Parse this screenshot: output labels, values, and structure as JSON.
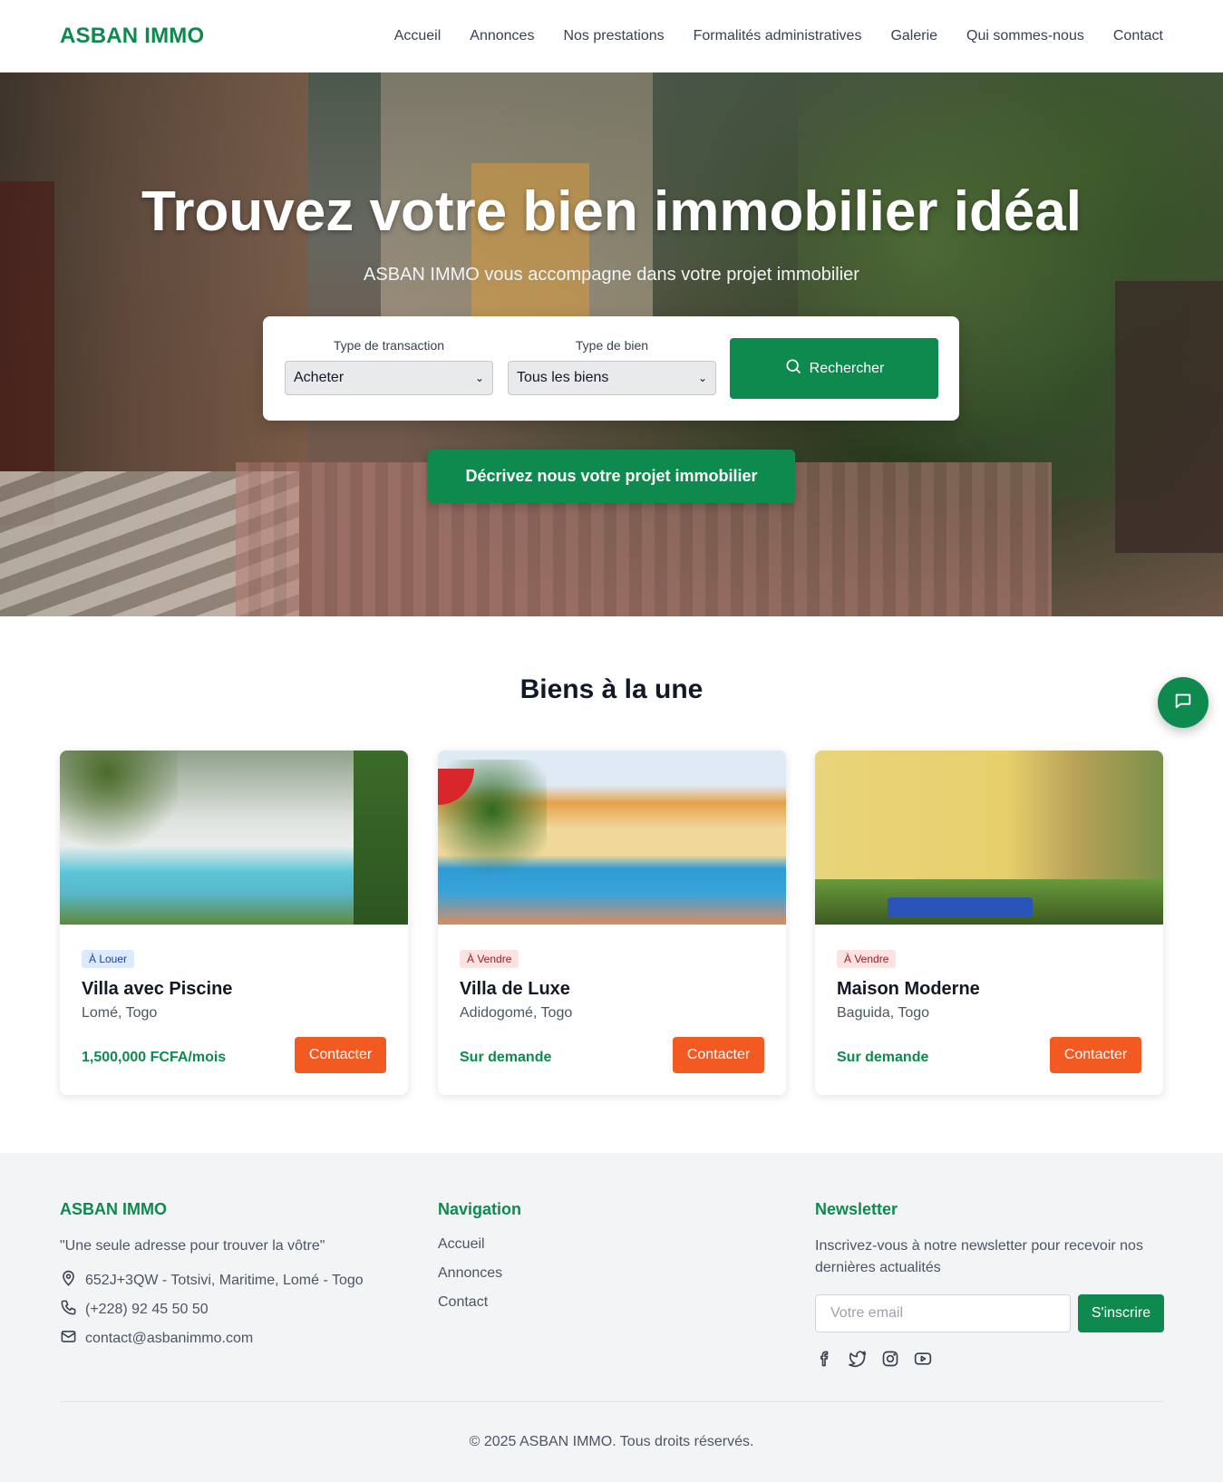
{
  "header": {
    "logo": "ASBAN IMMO",
    "nav": [
      "Accueil",
      "Annonces",
      "Nos prestations",
      "Formalités administratives",
      "Galerie",
      "Qui sommes-nous",
      "Contact"
    ]
  },
  "hero": {
    "title": "Trouvez votre bien immobilier idéal",
    "subtitle": "ASBAN IMMO vous accompagne dans votre projet immobilier",
    "search": {
      "transaction_label": "Type de transaction",
      "transaction_value": "Acheter",
      "property_label": "Type de bien",
      "property_value": "Tous les biens",
      "button": "Rechercher"
    },
    "project_button": "Décrivez nous votre projet immobilier"
  },
  "featured": {
    "title": "Biens à la une",
    "cards": [
      {
        "badge": "À Louer",
        "badge_type": "rent",
        "title": "Villa avec Piscine",
        "location": "Lomé, Togo",
        "price": "1,500,000 FCFA/mois",
        "button": "Contacter"
      },
      {
        "badge": "À Vendre",
        "badge_type": "sale",
        "title": "Villa de Luxe",
        "location": "Adidogomé, Togo",
        "price": "Sur demande",
        "button": "Contacter"
      },
      {
        "badge": "À Vendre",
        "badge_type": "sale",
        "title": "Maison Moderne",
        "location": "Baguida, Togo",
        "price": "Sur demande",
        "button": "Contacter"
      }
    ]
  },
  "footer": {
    "brand": {
      "title": "ASBAN IMMO",
      "tagline": "\"Une seule adresse pour trouver la vôtre\"",
      "address": "652J+3QW - Totsivi, Maritime, Lomé - Togo",
      "phone": "(+228) 92 45 50 50",
      "email": "contact@asbanimmo.com"
    },
    "navigation": {
      "title": "Navigation",
      "links": [
        "Accueil",
        "Annonces",
        "Contact"
      ]
    },
    "newsletter": {
      "title": "Newsletter",
      "text": "Inscrivez-vous à notre newsletter pour recevoir nos dernières actualités",
      "placeholder": "Votre email",
      "button": "S'inscrire",
      "socials": [
        "facebook-icon",
        "twitter-icon",
        "instagram-icon",
        "youtube-icon"
      ]
    },
    "copyright": "© 2025 ASBAN IMMO. Tous droits réservés."
  },
  "colors": {
    "brand_green": "#0e8a4f",
    "accent_orange": "#f25a22"
  }
}
